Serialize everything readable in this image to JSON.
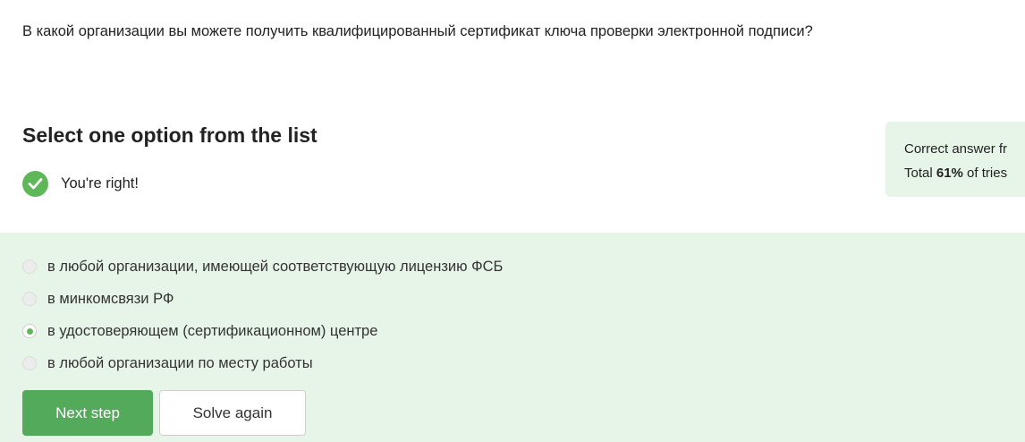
{
  "question": {
    "text": "В какой организации вы можете получить квалифицированный сертификат ключа проверки электронной подписи?"
  },
  "task": {
    "title": "Select one option from the list"
  },
  "feedback": {
    "icon": "check-circle-icon",
    "text": "You're right!",
    "color": "#5eb858"
  },
  "stats": {
    "line1": "Correct answer fr",
    "line2_prefix": "Total ",
    "line2_value": "61%",
    "line2_suffix": " of tries"
  },
  "options": [
    {
      "label": "в любой организации, имеющей соответствующую лицензию ФСБ",
      "selected": false
    },
    {
      "label": "в минкомсвязи РФ",
      "selected": false
    },
    {
      "label": "в удостоверяющем (сертификационном) центре",
      "selected": true
    },
    {
      "label": "в любой организации по месту работы",
      "selected": false
    }
  ],
  "buttons": {
    "next": "Next step",
    "solve_again": "Solve again"
  },
  "colors": {
    "accent": "#53aa5b",
    "answer_background": "#e7f5e9"
  }
}
